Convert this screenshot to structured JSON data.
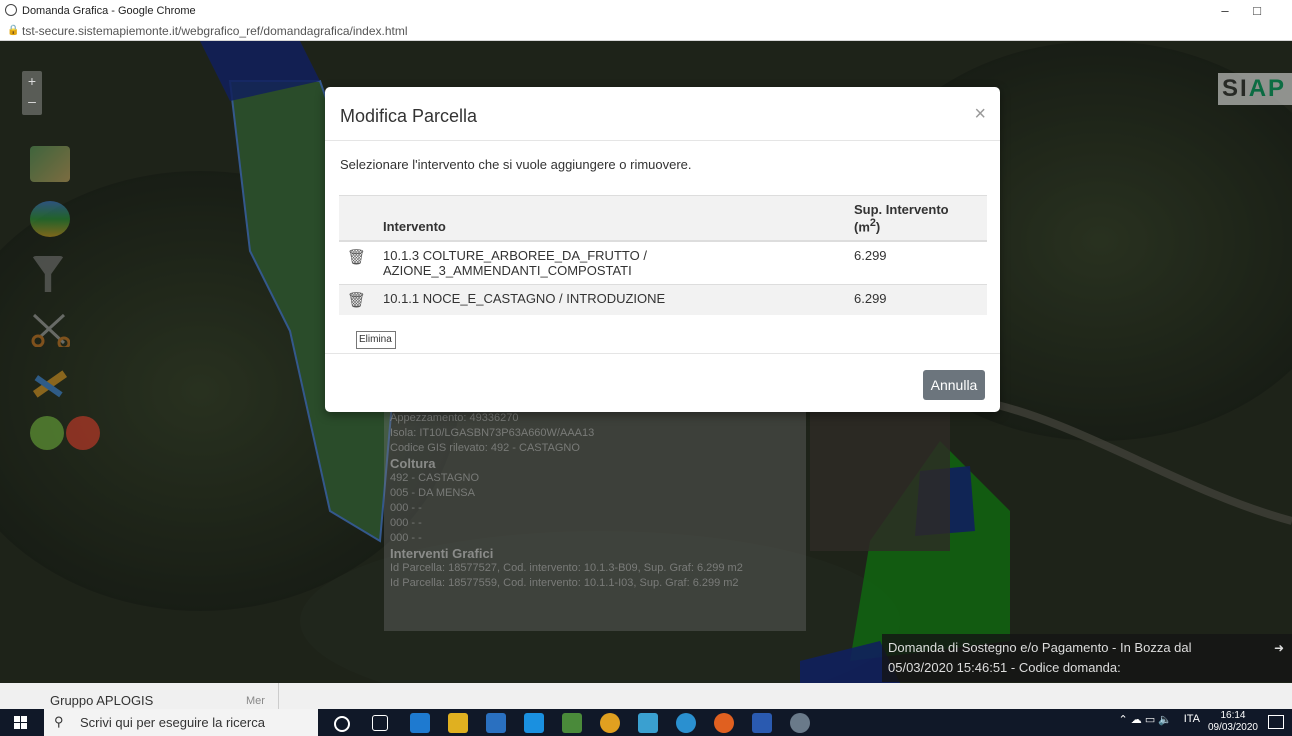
{
  "browser": {
    "title": "Domanda Grafica - Google Chrome",
    "url": "tst-secure.sistemapiemonte.it/webgrafico_ref/domandagrafica/index.html",
    "minimize": "–",
    "maximize": "□"
  },
  "map": {
    "zoom_in": "+",
    "zoom_out": "–",
    "logo_prefix": "SI",
    "logo_suffix": "AP",
    "colors": {
      "green_parcel": "#1fb31f",
      "blue_parcel": "#1e3aa8"
    }
  },
  "info_panel": {
    "appezzamento": "Appezzamento: 49336270",
    "isola": "Isola: IT10/LGASBN73P63A660W/AAA13",
    "codice_gis": "Codice GIS rilevato: 492 - CASTAGNO",
    "coltura_heading": "Coltura",
    "coltura_lines": [
      "492 - CASTAGNO",
      "005 - DA MENSA",
      "000 - -",
      "000 - -",
      "000 - -"
    ],
    "interventi_heading": "Interventi Grafici",
    "interventi_lines": [
      "Id Parcella: 18577527, Cod. intervento: 10.1.3-B09, Sup. Graf: 6.299 m2",
      "Id Parcella: 18577559, Cod. intervento: 10.1.1-I03, Sup. Graf: 6.299 m2"
    ]
  },
  "status_bar": {
    "line1": "Domanda di Sostegno e/o Pagamento - In Bozza dal",
    "line2": "05/03/2020 15:46:51 - Codice domanda:",
    "arrow": "➜"
  },
  "modal": {
    "title": "Modifica Parcella",
    "close": "×",
    "instruction": "Selezionare l'intervento che si vuole aggiungere o rimuovere.",
    "columns": {
      "intervento": "Intervento",
      "sup": "Sup. Intervento",
      "unit_prefix": "(m",
      "unit_exp": "2",
      "unit_suffix": ")"
    },
    "rows": [
      {
        "intervento_line1": "10.1.3 COLTURE_ARBOREE_DA_FRUTTO /",
        "intervento_line2": "AZIONE_3_AMMENDANTI_COMPOSTATI",
        "sup": "6.299"
      },
      {
        "intervento_line1": "10.1.1 NOCE_E_CASTAGNO / INTRODUZIONE",
        "intervento_line2": "",
        "sup": "6.299"
      }
    ],
    "tooltip": "Elimina",
    "cancel_button": "Annulla"
  },
  "strip": {
    "group": "Gruppo APLOGIS",
    "day": "Mer"
  },
  "taskbar": {
    "search_placeholder": "Scrivi qui per eseguire la ricerca",
    "language": "ITA",
    "time": "16:14",
    "date": "09/03/2020"
  }
}
